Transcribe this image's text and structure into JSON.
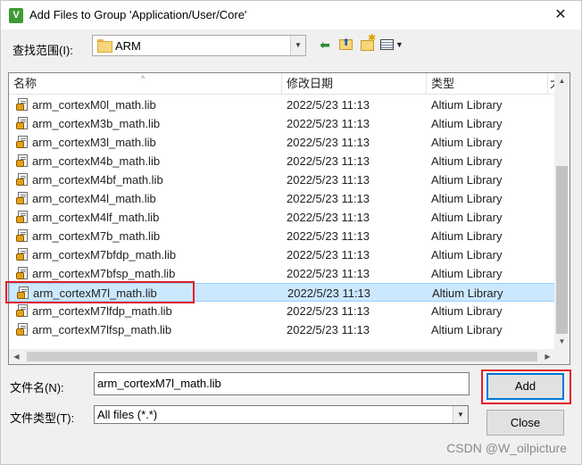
{
  "window": {
    "title": "Add Files to Group 'Application/User/Core'",
    "close_glyph": "✕",
    "app_icon_letter": "V"
  },
  "toolbar": {
    "lookin_label": "查找范围(I):",
    "lookin_value": "ARM",
    "icons": [
      "back-arrow-icon",
      "up-folder-icon",
      "new-folder-icon",
      "view-menu-icon"
    ]
  },
  "list": {
    "columns": [
      "名称",
      "修改日期",
      "类型",
      "大"
    ],
    "rows": [
      {
        "name": "arm_cortexM0l_math.lib",
        "date": "2022/5/23 11:13",
        "type": "Altium Library"
      },
      {
        "name": "arm_cortexM3b_math.lib",
        "date": "2022/5/23 11:13",
        "type": "Altium Library"
      },
      {
        "name": "arm_cortexM3l_math.lib",
        "date": "2022/5/23 11:13",
        "type": "Altium Library"
      },
      {
        "name": "arm_cortexM4b_math.lib",
        "date": "2022/5/23 11:13",
        "type": "Altium Library"
      },
      {
        "name": "arm_cortexM4bf_math.lib",
        "date": "2022/5/23 11:13",
        "type": "Altium Library"
      },
      {
        "name": "arm_cortexM4l_math.lib",
        "date": "2022/5/23 11:13",
        "type": "Altium Library"
      },
      {
        "name": "arm_cortexM4lf_math.lib",
        "date": "2022/5/23 11:13",
        "type": "Altium Library"
      },
      {
        "name": "arm_cortexM7b_math.lib",
        "date": "2022/5/23 11:13",
        "type": "Altium Library"
      },
      {
        "name": "arm_cortexM7bfdp_math.lib",
        "date": "2022/5/23 11:13",
        "type": "Altium Library"
      },
      {
        "name": "arm_cortexM7bfsp_math.lib",
        "date": "2022/5/23 11:13",
        "type": "Altium Library"
      },
      {
        "name": "arm_cortexM7l_math.lib",
        "date": "2022/5/23 11:13",
        "type": "Altium Library"
      },
      {
        "name": "arm_cortexM7lfdp_math.lib",
        "date": "2022/5/23 11:13",
        "type": "Altium Library"
      },
      {
        "name": "arm_cortexM7lfsp_math.lib",
        "date": "2022/5/23 11:13",
        "type": "Altium Library"
      }
    ],
    "selected_index": 10
  },
  "form": {
    "filename_label": "文件名(N):",
    "filename_value": "arm_cortexM7l_math.lib",
    "filetype_label": "文件类型(T):",
    "filetype_value": "All files (*.*)"
  },
  "buttons": {
    "add_label": "Add",
    "close_label": "Close"
  },
  "watermark": "CSDN @W_oilpicture",
  "colors": {
    "selection_bg": "#cce8ff",
    "highlight_box": "#e11d2b",
    "default_button_border": "#0078d7"
  }
}
